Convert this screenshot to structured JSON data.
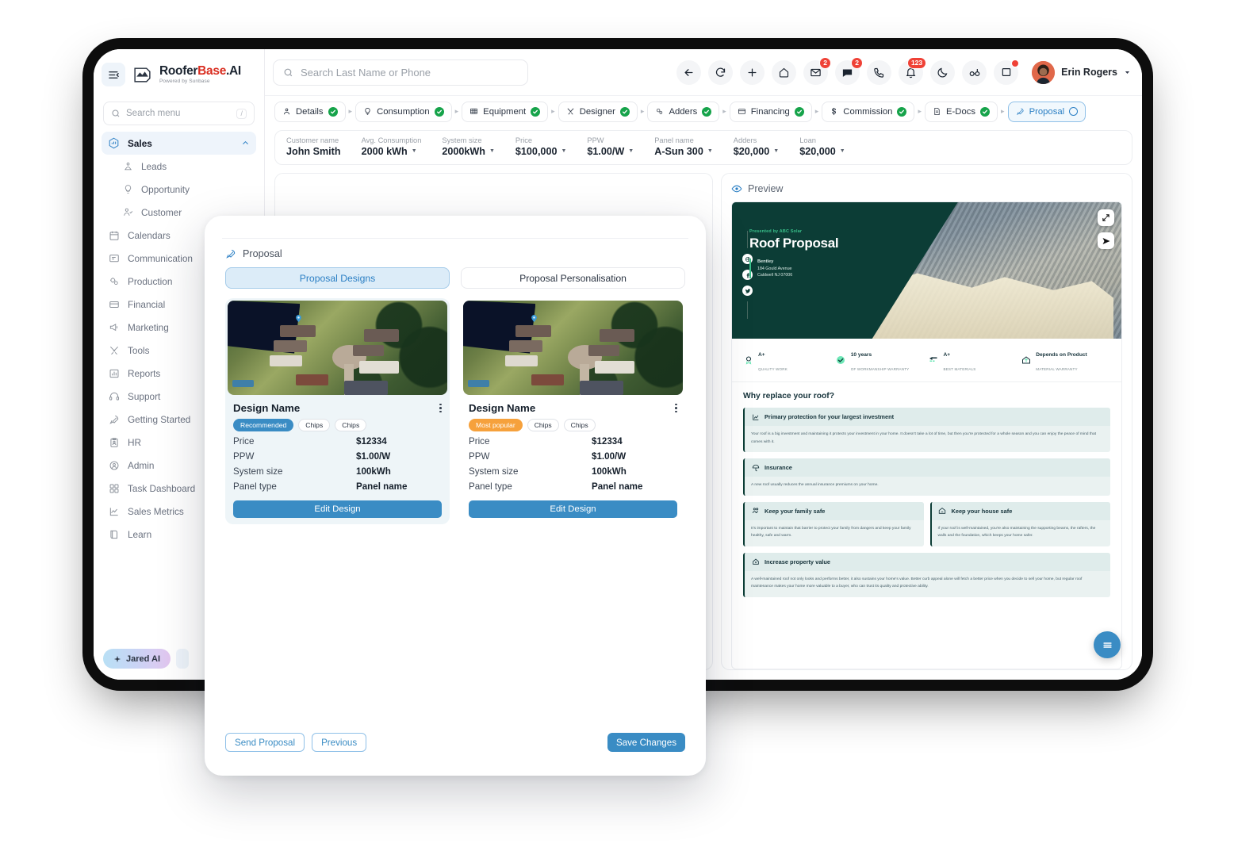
{
  "brand": {
    "name_part1": "Roofer",
    "name_part2": "Base",
    "name_part3": ".AI",
    "tagline": "Powered by Sunbase"
  },
  "sidebar": {
    "search_placeholder": "Search menu",
    "search_shortcut": "/",
    "section": {
      "label": "Sales"
    },
    "sub_items": [
      {
        "label": "Leads",
        "icon": "leads-icon"
      },
      {
        "label": "Opportunity",
        "icon": "bulb-icon"
      },
      {
        "label": "Customer",
        "icon": "user-check-icon"
      }
    ],
    "items": [
      {
        "label": "Calendars",
        "icon": "calendar-icon"
      },
      {
        "label": "Communication",
        "icon": "chat-icon"
      },
      {
        "label": "Production",
        "icon": "gears-icon"
      },
      {
        "label": "Financial",
        "icon": "wallet-icon"
      },
      {
        "label": "Marketing",
        "icon": "megaphone-icon"
      },
      {
        "label": "Tools",
        "icon": "tools-icon"
      },
      {
        "label": "Reports",
        "icon": "bar-chart-icon"
      },
      {
        "label": "Support",
        "icon": "headset-icon"
      },
      {
        "label": "Getting Started",
        "icon": "rocket-icon"
      },
      {
        "label": "HR",
        "icon": "clipboard-user-icon"
      },
      {
        "label": "Admin",
        "icon": "shield-user-icon"
      },
      {
        "label": "Task Dashboard",
        "icon": "grid-icon"
      },
      {
        "label": "Sales Metrics",
        "icon": "line-chart-icon"
      },
      {
        "label": "Learn",
        "icon": "book-icon"
      }
    ],
    "assistant": {
      "label": "Jared AI"
    }
  },
  "topbar": {
    "search_placeholder": "Search Last Name or Phone",
    "actions": [
      {
        "name": "back-icon",
        "badge": ""
      },
      {
        "name": "refresh-icon",
        "badge": ""
      },
      {
        "name": "plus-icon",
        "badge": ""
      },
      {
        "name": "home-icon",
        "badge": ""
      },
      {
        "name": "mail-icon",
        "badge": "2"
      },
      {
        "name": "message-icon",
        "badge": "2"
      },
      {
        "name": "phone-icon",
        "badge": ""
      },
      {
        "name": "bell-icon",
        "badge": "123"
      },
      {
        "name": "moon-icon",
        "badge": ""
      },
      {
        "name": "glasses-icon",
        "badge": ""
      },
      {
        "name": "window-icon",
        "badge": "dot"
      }
    ],
    "user": {
      "name": "Erin Rogers"
    }
  },
  "stepper": {
    "steps": [
      {
        "label": "Details",
        "icon": "user-icon",
        "state": "complete"
      },
      {
        "label": "Consumption",
        "icon": "bulb-icon",
        "state": "complete"
      },
      {
        "label": "Equipment",
        "icon": "panel-icon",
        "state": "complete"
      },
      {
        "label": "Designer",
        "icon": "tools-icon",
        "state": "complete"
      },
      {
        "label": "Adders",
        "icon": "gears-icon",
        "state": "complete"
      },
      {
        "label": "Financing",
        "icon": "card-icon",
        "state": "complete"
      },
      {
        "label": "Commission",
        "icon": "dollar-icon",
        "state": "complete"
      },
      {
        "label": "E-Docs",
        "icon": "doc-icon",
        "state": "complete"
      },
      {
        "label": "Proposal",
        "icon": "rocket-icon",
        "state": "current"
      }
    ]
  },
  "meta": [
    {
      "label": "Customer name",
      "value": "John Smith",
      "dropdown": false
    },
    {
      "label": "Avg. Consumption",
      "value": "2000 kWh",
      "dropdown": true
    },
    {
      "label": "System size",
      "value": "2000kWh",
      "dropdown": true
    },
    {
      "label": "Price",
      "value": "$100,000",
      "dropdown": true
    },
    {
      "label": "PPW",
      "value": "$1.00/W",
      "dropdown": true
    },
    {
      "label": "Panel name",
      "value": "A-Sun 300",
      "dropdown": true
    },
    {
      "label": "Adders",
      "value": "$20,000",
      "dropdown": true
    },
    {
      "label": "Loan",
      "value": "$20,000",
      "dropdown": true
    }
  ],
  "modal": {
    "title": "Proposal",
    "tabs": [
      {
        "label": "Proposal Designs",
        "active": true
      },
      {
        "label": "Proposal Personalisation",
        "active": false
      }
    ],
    "designs": [
      {
        "title": "Design Name",
        "badge": "Recommended",
        "badge_color": "#3a8cc4",
        "chips": [
          "Chips",
          "Chips"
        ],
        "selected": true,
        "rows": [
          {
            "key": "Price",
            "value": "$12334"
          },
          {
            "key": "PPW",
            "value": "$1.00/W"
          },
          {
            "key": "System size",
            "value": "100kWh"
          },
          {
            "key": "Panel type",
            "value": "Panel name"
          }
        ],
        "cta": "Edit Design"
      },
      {
        "title": "Design Name",
        "badge": "Most popular",
        "badge_color": "#f6a13c",
        "chips": [
          "Chips",
          "Chips"
        ],
        "selected": false,
        "rows": [
          {
            "key": "Price",
            "value": "$12334"
          },
          {
            "key": "PPW",
            "value": "$1.00/W"
          },
          {
            "key": "System size",
            "value": "100kWh"
          },
          {
            "key": "Panel type",
            "value": "Panel name"
          }
        ],
        "cta": "Edit Design"
      }
    ],
    "footer": {
      "send": "Send Proposal",
      "previous": "Previous",
      "save": "Save Changes"
    }
  },
  "preview": {
    "label": "Preview",
    "hero": {
      "eyebrow": "Presented by ABC Solar",
      "title": "Roof Proposal",
      "company": "Bentley",
      "address_line1": "184 Gould Avenue",
      "address_line2": "Caldwell NJ 07006"
    },
    "badges": [
      {
        "title": "A+",
        "sub": "QUALITY WORK",
        "icon": "medal-icon"
      },
      {
        "title": "10 years",
        "sub": "OF WORKMANSHIP WARRANTY",
        "icon": "check-badge-icon"
      },
      {
        "title": "A+",
        "sub": "BEST MATERIALS",
        "icon": "materials-icon"
      },
      {
        "title": "Depends on Product",
        "sub": "MATERIAL WARRANTY",
        "icon": "home-shield-icon"
      }
    ],
    "section_title": "Why replace your roof?",
    "cards": [
      {
        "title": "Primary protection for your largest investment",
        "icon": "chart-up-icon",
        "body": "Your roof is a big investment and maintaining it protects your investment in your home. It doesn't take a lot of time, but then you're protected for a whole season and you can enjoy the peace of mind that comes with it.",
        "full": true
      },
      {
        "title": "Insurance",
        "icon": "umbrella-icon",
        "body": "A new roof usually reduces the annual insurance premiums on your home.",
        "full": true
      },
      {
        "title": "Keep your family safe",
        "icon": "family-icon",
        "body": "It's important to maintain that barrier to protect your family from dangers and keep your family healthy, safe and warm.",
        "full": false
      },
      {
        "title": "Keep your house safe",
        "icon": "house-shield-icon",
        "body": "If your roof is well-maintained, you're also maintaining the supporting beams, the rafters, the walls and the foundation, which keeps your home safer.",
        "full": false
      },
      {
        "title": "Increase property value",
        "icon": "house-value-icon",
        "body": "A well-maintained roof not only looks and performs better, it also sustains your home's value. Better curb appeal alone will fetch a better price when you decide to sell your home, but regular roof maintenance makes your home more valuable to a buyer, who can trust its quality and protective ability.",
        "full": true
      }
    ]
  }
}
